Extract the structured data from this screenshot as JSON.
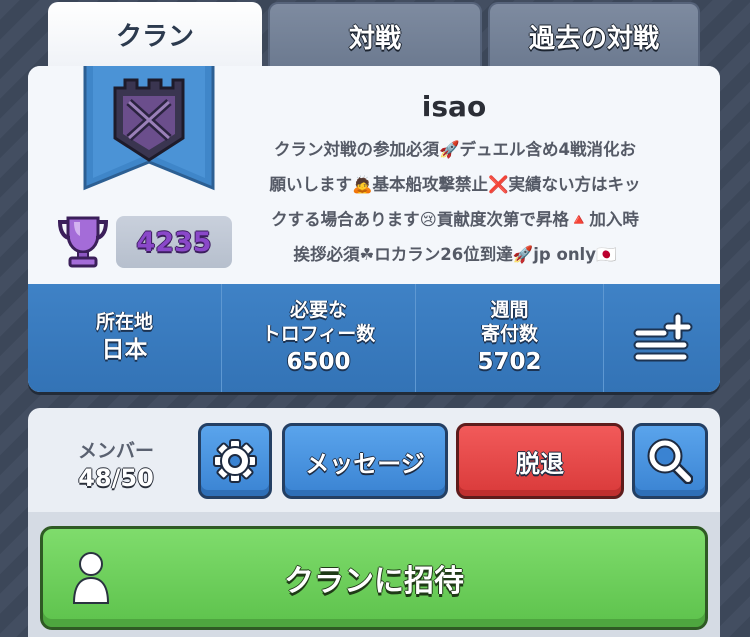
{
  "tabs": [
    {
      "label": "クラン"
    },
    {
      "label": "対戦"
    },
    {
      "label": "過去の対戦"
    }
  ],
  "clan": {
    "name": "isao",
    "trophies": "4235",
    "description_lines": [
      "クラン対戦の参加必須🚀デュエル含め4戦消化お",
      "願いします🙇基本船攻撃禁止❌実績ない方はキッ",
      "クする場合あります😢貢献度次第で昇格🔺加入時",
      "挨拶必須☘ロカラン26位到達🚀jp only🇯🇵"
    ]
  },
  "stats": {
    "location": {
      "label": "所在地",
      "value": "日本"
    },
    "required_trophies": {
      "label_line1": "必要な",
      "label_line2": "トロフィー数",
      "value": "6500"
    },
    "weekly_donations": {
      "label_line1": "週間",
      "label_line2": "寄付数",
      "value": "5702"
    }
  },
  "members": {
    "label": "メンバー",
    "count": "48/50"
  },
  "buttons": {
    "message": "メッセージ",
    "leave": "脱退",
    "invite": "クランに招待"
  },
  "icons": {
    "settings": "gear-icon",
    "search": "magnifier-icon",
    "more": "list-plus-icon",
    "trophy": "trophy-icon",
    "invite": "person-icon"
  },
  "colors": {
    "trophy_purple": "#8a48c9",
    "stats_blue": "#3a7bbf",
    "leave_red": "#d93a3a",
    "invite_green": "#5dc24c"
  }
}
